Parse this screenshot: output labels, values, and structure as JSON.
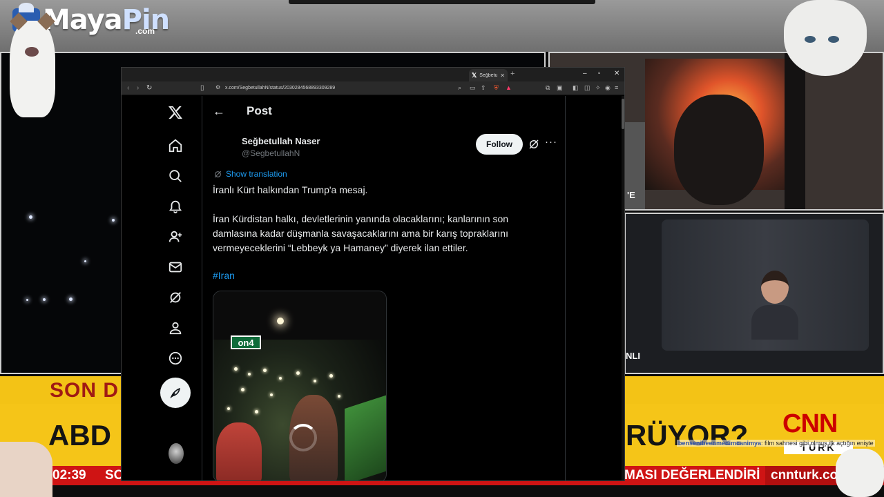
{
  "stream": {
    "logo_main": "Maya",
    "logo_accent": "Pin",
    "logo_sub": ".com",
    "caption_top_right": "'E",
    "caption_mid_right": "NLI"
  },
  "ticker": {
    "top_label": "SON D",
    "main_left": "ABD",
    "main_right": "RÜYOR?",
    "cnn_logo": "CNN",
    "cnn_sub": "TÜRK",
    "time": "02:39",
    "time_after": "SO",
    "headline": "MASI DEĞERLENDİRİ",
    "site": "cnnturk.co",
    "chat_user": "bensenibeenmedimcanimya",
    "chat_message": ": film sahnesi gibi olmuş ilk açtığın enişte",
    "colors": {
      "ticker_yellow": "#f5c518",
      "ticker_red": "#cf1414",
      "cnn_red": "#cc0000"
    }
  },
  "browser": {
    "tab_title": "Seğbetu",
    "url": "x.com/SegbetullahN/status/2030284568893309289"
  },
  "x": {
    "page_title": "Post",
    "author": {
      "name": "Seğbetullah Naser",
      "handle": "@SegbetullahN"
    },
    "follow_label": "Follow",
    "translate_label": "Show translation",
    "tweet_lines": [
      "İranlı Kürt halkından Trump'a mesaj.",
      "İran Kürdistan halkı, devletlerinin yanında olacaklarını; kanlarının son damlasına kadar düşmanla savaşacaklarını  ama bir karış topraklarını vermeyeceklerini “Lebbeyk ya Hamaney” diyerek ilan ettiler."
    ],
    "hashtag": "#Iran",
    "media_badge": "on4",
    "sidebar_icons": [
      "x-logo-icon",
      "home-icon",
      "search-icon",
      "notifications-icon",
      "follow-icon",
      "messages-icon",
      "grok-icon",
      "profile-icon",
      "more-icon"
    ],
    "colors": {
      "link": "#1d9bf0",
      "text": "#e7e9ea",
      "muted": "#71767b"
    }
  }
}
